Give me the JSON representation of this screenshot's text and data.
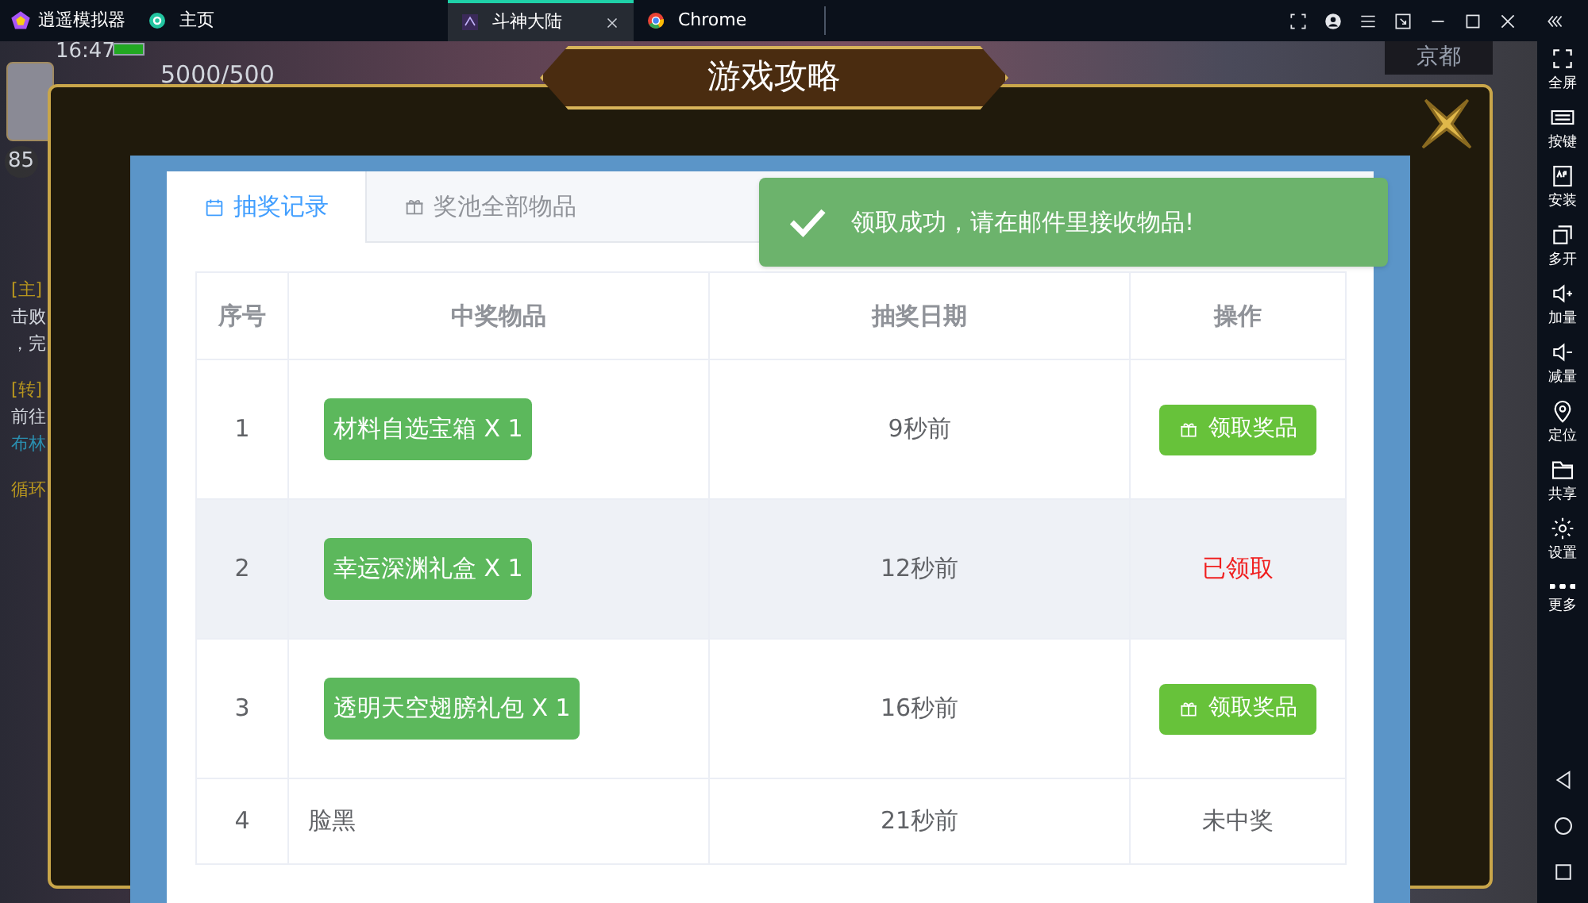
{
  "titlebar": {
    "app_name": "逍遥模拟器",
    "tabs": [
      {
        "label": "主页",
        "selected": false,
        "closable": false
      },
      {
        "label": "斗神大陆",
        "selected": true,
        "closable": true
      },
      {
        "label": "Chrome",
        "selected": false,
        "closable": false
      }
    ]
  },
  "game_hud": {
    "time": "16:47",
    "energy": "5000/500",
    "level": "85",
    "location": "京都",
    "quest_lines": [
      {
        "text": "[主]",
        "kind": "tag"
      },
      {
        "text": "击败",
        "kind": "plain"
      },
      {
        "text": "，完",
        "kind": "plain"
      },
      {
        "text": "[转]",
        "kind": "tag"
      },
      {
        "text": "前往",
        "kind": "plain"
      },
      {
        "text": "布林",
        "kind": "link"
      },
      {
        "text": "循环",
        "kind": "tag"
      }
    ]
  },
  "dialog": {
    "title": "游戏攻略",
    "tabs": [
      {
        "label": "抽奖记录",
        "selected": true
      },
      {
        "label": "奖池全部物品",
        "selected": false
      }
    ],
    "toast": {
      "message": "领取成功，请在邮件里接收物品!"
    },
    "table": {
      "columns": [
        "序号",
        "中奖物品",
        "抽奖日期",
        "操作"
      ],
      "rows": [
        {
          "index": "1",
          "item": "材料自选宝箱 X 1",
          "kind": "prize",
          "date": "9秒前",
          "action": {
            "kind": "claim",
            "label": "领取奖品"
          },
          "highlighted": false
        },
        {
          "index": "2",
          "item": "幸运深渊礼盒 X 1",
          "kind": "prize",
          "date": "12秒前",
          "action": {
            "kind": "claimed",
            "label": "已领取"
          },
          "highlighted": true
        },
        {
          "index": "3",
          "item": "透明天空翅膀礼包 X 1",
          "kind": "prize",
          "date": "16秒前",
          "action": {
            "kind": "claim",
            "label": "领取奖品"
          },
          "highlighted": false
        },
        {
          "index": "4",
          "item": "脸黑",
          "kind": "none",
          "date": "21秒前",
          "action": {
            "kind": "none",
            "label": "未中奖"
          },
          "highlighted": false
        }
      ]
    }
  },
  "side_toolbar": [
    "全屏",
    "按键",
    "安装",
    "多开",
    "加量",
    "减量",
    "定位",
    "共享",
    "设置",
    "更多"
  ]
}
